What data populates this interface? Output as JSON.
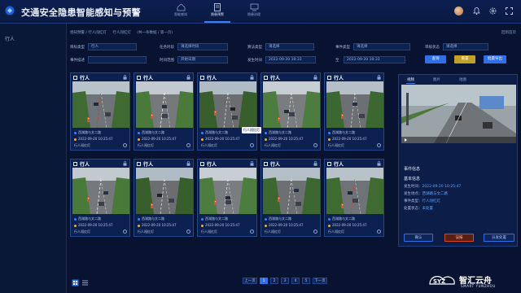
{
  "header": {
    "title": "交通安全隐患智能感知与预警",
    "nav": [
      {
        "label": "智能感知",
        "active": false
      },
      {
        "label": "隐患预警",
        "active": true
      },
      {
        "label": "隐患治理",
        "active": false
      }
    ]
  },
  "sidebar": {
    "items": [
      {
        "label": "行人"
      }
    ]
  },
  "breadcrumb": {
    "items": [
      "感知预警 / 行人闯红灯",
      "行人闯红灯",
      "(共一条数据 / 第一页)"
    ],
    "right": "回到首页"
  },
  "filters": {
    "row1": [
      {
        "label": "目标类型",
        "value": "行人"
      },
      {
        "label": "任务时段",
        "value": "请选择时段"
      },
      {
        "label": "算法类型",
        "value": "请选择"
      },
      {
        "label": "事件类型",
        "value": "请选择"
      },
      {
        "label": "审核状态",
        "value": "请选择"
      }
    ],
    "row2": [
      {
        "label": "事件描述",
        "value": ""
      },
      {
        "label": "时间范围",
        "value": "开始日期"
      },
      {
        "label": "发生时间",
        "value": "2022-09-20 10:33"
      },
      {
        "label": "至",
        "value": "2022-09-20 10:33"
      }
    ],
    "buttons": {
      "search": "查询",
      "reset": "重置",
      "export": "批量导出"
    }
  },
  "cards": [
    {
      "title": "行人",
      "loc": "西湖路与文二路",
      "time": "2022-09-20 10:25:47",
      "meta": "行人闯红灯"
    },
    {
      "title": "行人",
      "loc": "西湖路与文二路",
      "time": "2022-09-20 10:25:47",
      "meta": "行人闯红灯"
    },
    {
      "title": "行人",
      "loc": "西湖路与文二路",
      "time": "2022-09-20 10:25:47",
      "meta": "行人闯红灯"
    },
    {
      "title": "行人",
      "loc": "西湖路与文二路",
      "time": "2022-09-20 10:25:47",
      "meta": "行人闯红灯"
    },
    {
      "title": "行人",
      "loc": "西湖路与文二路",
      "time": "2022-09-20 10:25:47",
      "meta": "行人闯红灯"
    },
    {
      "title": "行人",
      "loc": "西湖路与文二路",
      "time": "2022-09-20 10:25:47",
      "meta": "行人闯红灯"
    },
    {
      "title": "行人",
      "loc": "西湖路与文二路",
      "time": "2022-09-20 10:25:47",
      "meta": "行人闯红灯"
    },
    {
      "title": "行人",
      "loc": "西湖路与文二路",
      "time": "2022-09-20 10:25:47",
      "meta": "行人闯红灯"
    },
    {
      "title": "行人",
      "loc": "西湖路与文二路",
      "time": "2022-09-20 10:25:47",
      "meta": "行人闯红灯"
    },
    {
      "title": "行人",
      "loc": "西湖路与文二路",
      "time": "2022-09-20 10:25:47",
      "meta": "行人闯红灯"
    }
  ],
  "tooltip": "行人闯红灯",
  "detail": {
    "tabs": [
      "视频",
      "图片",
      "地图"
    ],
    "section1": "事件信息",
    "section2": "基本信息",
    "fields": [
      {
        "k": "发生时间：",
        "v": "2022-09-20 10:25:47"
      },
      {
        "k": "发生地点：",
        "v": "西湖路与文二路"
      },
      {
        "k": "事件类型：",
        "v": "行人闯红灯"
      },
      {
        "k": "处置状态：",
        "v": "未处置"
      }
    ],
    "buttons": {
      "a": "确认",
      "b": "误报",
      "c": "派发处置"
    }
  },
  "pager": {
    "pages": [
      "1",
      "2",
      "3",
      "4",
      "5"
    ],
    "prev": "上一页",
    "next": "下一页"
  },
  "watermark": {
    "text": "智汇云舟",
    "sub": "SMART YUNZHOU"
  },
  "colors": {
    "bg": "#071331",
    "accent": "#2f6fe8",
    "warn": "#d34a22"
  }
}
